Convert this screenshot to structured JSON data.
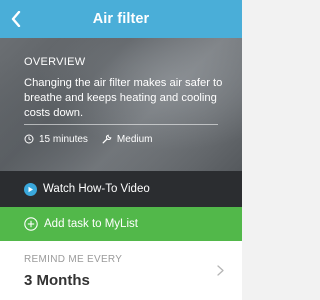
{
  "header": {
    "title": "Air filter"
  },
  "overview": {
    "label": "OVERVIEW",
    "text": "Changing the air filter makes air safer to breathe and keeps heating and cooling costs down.",
    "duration": "15 minutes",
    "difficulty": "Medium"
  },
  "video": {
    "label": "Watch How-To Video"
  },
  "add_task": {
    "label": "Add task to MyList"
  },
  "reminder": {
    "label": "REMIND ME EVERY",
    "value": "3 Months"
  },
  "colors": {
    "header": "#4aaed8",
    "video_bar": "#2b2d30",
    "add_bar": "#52b84a",
    "play_icon": "#3aa8dc"
  },
  "icons": [
    "back-arrow-icon",
    "clock-icon",
    "wrench-icon",
    "play-icon",
    "plus-circle-icon",
    "chevron-right-icon"
  ]
}
